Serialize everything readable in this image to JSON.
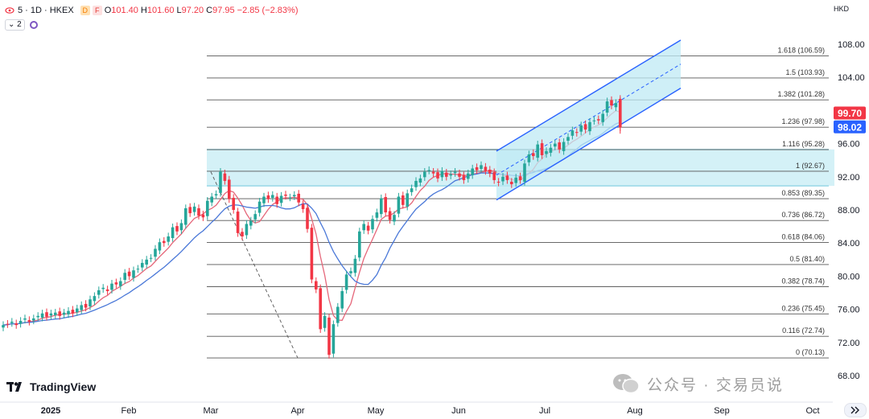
{
  "header": {
    "symbol_label": "5 · 1D · HKEX",
    "badge_d": "D",
    "badge_f": "F",
    "open_label": "O",
    "open_value": "101.40",
    "high_label": "H",
    "high_value": "101.60",
    "low_label": "L",
    "low_value": "97.20",
    "close_label": "C",
    "close_value": "97.95",
    "change_value": "−2.85 (−2.83%)",
    "indicator_count": "2"
  },
  "currency": "HKD",
  "brand": "TradingView",
  "watermark": "公众号 · 交易员说",
  "colors": {
    "up": "#26a69a",
    "down": "#f23645",
    "ma_fast": "#e5677a",
    "ma_slow": "#4a78d8",
    "channel": "#2962ff",
    "zone": "#cdeef6",
    "fib_line": "#555555",
    "price_tag": "#f23645",
    "ma_tag": "#2962ff"
  },
  "chart_data": {
    "type": "candlestick",
    "ylim": [
      66,
      110
    ],
    "y_ticks": [
      "108.00",
      "104.00",
      "100.00",
      "96.00",
      "92.00",
      "88.00",
      "84.00",
      "80.00",
      "76.00",
      "72.00",
      "68.00"
    ],
    "x_ticks": [
      "2025",
      "Feb",
      "Mar",
      "Apr",
      "May",
      "Jun",
      "Jul",
      "Aug",
      "Sep",
      "Oct"
    ],
    "fib_levels": [
      {
        "label": "1.618 (106.59)",
        "value": 106.59
      },
      {
        "label": "1.5 (103.93)",
        "value": 103.93
      },
      {
        "label": "1.382 (101.28)",
        "value": 101.28
      },
      {
        "label": "1.236 (97.98)",
        "value": 97.98
      },
      {
        "label": "1.116 (95.28)",
        "value": 95.28
      },
      {
        "label": "1 (92.67)",
        "value": 92.67
      },
      {
        "label": "0.853 (89.35)",
        "value": 89.35
      },
      {
        "label": "0.736 (86.72)",
        "value": 86.72
      },
      {
        "label": "0.618 (84.06)",
        "value": 84.06
      },
      {
        "label": "0.5 (81.40)",
        "value": 81.4
      },
      {
        "label": "0.382 (78.74)",
        "value": 78.74
      },
      {
        "label": "0.236 (75.45)",
        "value": 75.45
      },
      {
        "label": "0.116 (72.74)",
        "value": 72.74
      },
      {
        "label": "0 (70.13)",
        "value": 70.13
      }
    ],
    "zone": {
      "from": 90.9,
      "to": 95.3
    },
    "price_tags": [
      {
        "label": "99.70",
        "value": 99.7,
        "color": "#f23645"
      },
      {
        "label": "98.02",
        "value": 98.02,
        "color": "#2962ff"
      }
    ],
    "closes": [
      74.1,
      74.2,
      74.5,
      74.1,
      74.6,
      74.9,
      74.5,
      74.9,
      75.2,
      75.5,
      75.1,
      75.5,
      75.6,
      75.2,
      75.6,
      75.8,
      75.5,
      76.1,
      76.5,
      76.2,
      77.2,
      77.6,
      78.3,
      78.6,
      78.2,
      79.1,
      79.0,
      79.4,
      80.4,
      80.0,
      80.7,
      80.9,
      81.6,
      82.0,
      82.2,
      83.3,
      84.1,
      84.0,
      84.8,
      85.9,
      85.4,
      86.4,
      88.2,
      87.6,
      88.4,
      87.3,
      87.1,
      89.1,
      89.6,
      89.9,
      92.6,
      91.5,
      89.3,
      88.0,
      85.2,
      84.8,
      86.3,
      86.7,
      87.5,
      89.0,
      89.6,
      89.3,
      89.8,
      88.7,
      89.7,
      89.7,
      89.5,
      89.8,
      88.9,
      88.1,
      85.7,
      79.6,
      78.4,
      73.6,
      75.2,
      70.5,
      74.2,
      76.3,
      78.2,
      80.2,
      80.6,
      82.1,
      85.4,
      86.3,
      85.5,
      86.9,
      87.7,
      89.4,
      87.7,
      86.8,
      87.4,
      89.6,
      88.6,
      90.0,
      90.6,
      91.5,
      91.8,
      92.6,
      92.8,
      92.4,
      91.8,
      92.7,
      92.0,
      92.3,
      92.6,
      92.0,
      91.6,
      92.4,
      93.0,
      92.8,
      93.4,
      92.7,
      92.4,
      91.6,
      91.3,
      92.0,
      91.6,
      91.1,
      91.9,
      91.6,
      93.6,
      94.7,
      94.5,
      95.9,
      94.6,
      95.1,
      95.5,
      96.0,
      95.3,
      96.2,
      96.8,
      97.6,
      97.3,
      98.2,
      97.7,
      98.6,
      98.8,
      98.8,
      99.6,
      101.1,
      100.6,
      100.9,
      97.95
    ]
  }
}
